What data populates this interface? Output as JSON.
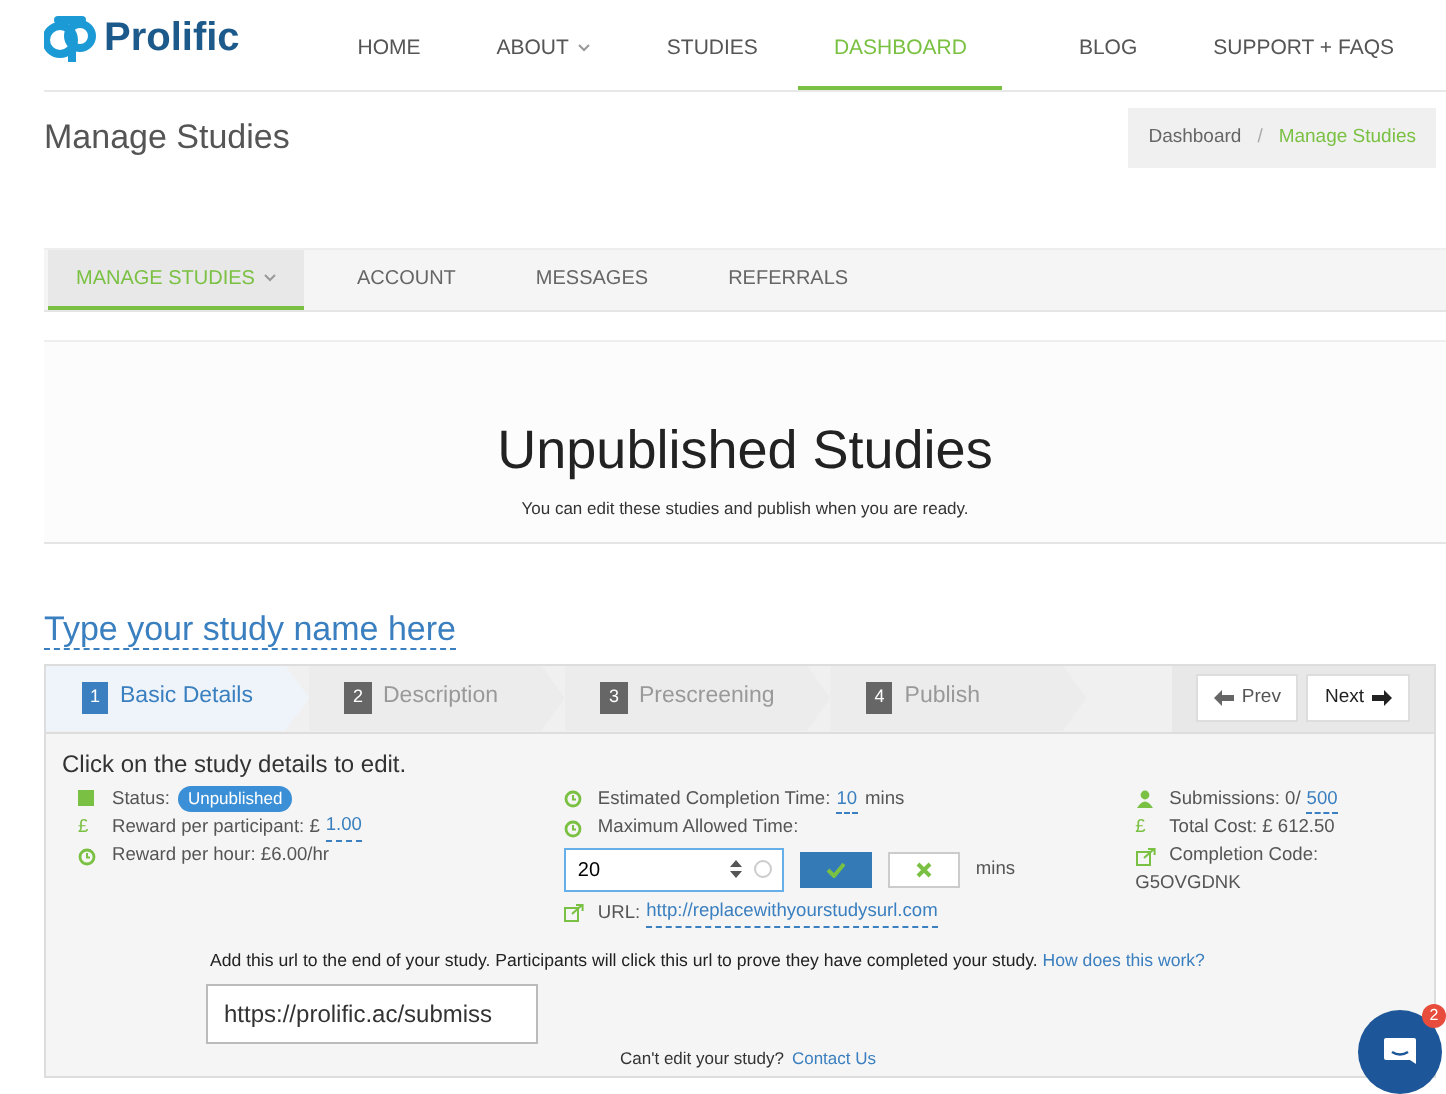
{
  "brand": {
    "name": "Prolific"
  },
  "nav": [
    {
      "label": "HOME",
      "selected": false,
      "dropdown": false
    },
    {
      "label": "ABOUT",
      "selected": false,
      "dropdown": true
    },
    {
      "label": "STUDIES",
      "selected": false,
      "dropdown": false
    },
    {
      "label": "DASHBOARD",
      "selected": true,
      "dropdown": false
    },
    {
      "label": "BLOG",
      "selected": false,
      "dropdown": false
    },
    {
      "label": "SUPPORT + FAQS",
      "selected": false,
      "dropdown": false
    }
  ],
  "page_title": "Manage Studies",
  "breadcrumb": [
    {
      "label": "Dashboard",
      "selected": false
    },
    {
      "label": "Manage Studies",
      "selected": true
    }
  ],
  "breadcrumb_separator": "/",
  "subnav": [
    {
      "label": "MANAGE STUDIES",
      "selected": true,
      "dropdown": true
    },
    {
      "label": "ACCOUNT",
      "selected": false,
      "dropdown": false
    },
    {
      "label": "MESSAGES",
      "selected": false,
      "dropdown": false
    },
    {
      "label": "REFERRALS",
      "selected": false,
      "dropdown": false
    }
  ],
  "heading": "Unpublished Studies",
  "subheading": "You can edit these studies and publish when you are ready.",
  "study_name": "Type your study name here",
  "steps": [
    {
      "number": "1",
      "label": "Basic Details",
      "selected": true
    },
    {
      "number": "2",
      "label": "Description",
      "selected": false
    },
    {
      "number": "3",
      "label": "Prescreening",
      "selected": false
    },
    {
      "number": "4",
      "label": "Publish",
      "selected": false
    }
  ],
  "pager": [
    {
      "label": "Prev",
      "kind": "prev"
    },
    {
      "label": "Next",
      "kind": "next"
    }
  ],
  "instructions": "Click on the study details to edit.",
  "details": [
    [
      {
        "kind": "status",
        "label": "Status:",
        "badge": "Unpublished"
      },
      {
        "kind": "pound",
        "icon": "£",
        "label": "Reward per participant: £",
        "value": "1.00"
      },
      {
        "kind": "clock",
        "label": "Reward per hour: £6.00/hr"
      }
    ],
    [
      {
        "kind": "clock",
        "label": "Estimated Completion Time:",
        "value": "10",
        "suffix": "mins"
      },
      {
        "kind": "clock",
        "label": "Maximum Allowed Time:"
      },
      {
        "kind": "editor",
        "value": "20",
        "suffix": "mins"
      },
      {
        "kind": "link",
        "label": "URL:",
        "value": "http://replacewithyourstudysurl.com"
      }
    ],
    [
      {
        "kind": "user",
        "label": "Submissions: 0/",
        "value": "500"
      },
      {
        "kind": "pound",
        "icon": "£",
        "label": "Total Cost: £ 612.50"
      },
      {
        "kind": "link",
        "label": "Completion Code:",
        "extra": "G5OVGDNK"
      }
    ]
  ],
  "completion": {
    "text": "Add this url to the end of your study. Participants will click this url to prove they have completed your study.",
    "link": "How does this work?",
    "url": "https://prolific.ac/submiss"
  },
  "footer": {
    "text": "Can't edit your study?",
    "link": "Contact Us"
  },
  "chat": {
    "badge": "2"
  }
}
